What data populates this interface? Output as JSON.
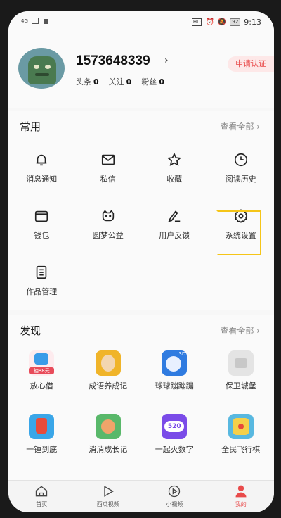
{
  "status_bar": {
    "signal": "4G",
    "hd": "HD",
    "battery": "92",
    "time": "9:13"
  },
  "profile": {
    "username": "1573648339",
    "stats": [
      {
        "label": "头条",
        "value": "0"
      },
      {
        "label": "关注",
        "value": "0"
      },
      {
        "label": "粉丝",
        "value": "0"
      }
    ],
    "verify_label": "申请认证"
  },
  "common": {
    "title": "常用",
    "more_label": "查看全部",
    "items": [
      {
        "label": "消息通知",
        "icon": "bell-icon"
      },
      {
        "label": "私信",
        "icon": "mail-icon"
      },
      {
        "label": "收藏",
        "icon": "star-icon"
      },
      {
        "label": "阅读历史",
        "icon": "clock-icon"
      },
      {
        "label": "钱包",
        "icon": "wallet-icon"
      },
      {
        "label": "圆梦公益",
        "icon": "charity-icon"
      },
      {
        "label": "用户反馈",
        "icon": "pen-icon"
      },
      {
        "label": "系统设置",
        "icon": "gear-icon"
      },
      {
        "label": "作品管理",
        "icon": "document-icon"
      }
    ]
  },
  "discover": {
    "title": "发现",
    "more_label": "查看全部",
    "items": [
      {
        "label": "放心借",
        "badge": "抽88元",
        "color": "#e84b5a"
      },
      {
        "label": "成语养成记",
        "color": "#f0b429"
      },
      {
        "label": "球球蹦蹦蹦",
        "badge": "3D",
        "color": "#2f7be0"
      },
      {
        "label": "保卫城堡",
        "color": "#dcdcdc"
      },
      {
        "label": "一锤到底",
        "color": "#3aa6e8"
      },
      {
        "label": "消消成长记",
        "color": "#59b86a"
      },
      {
        "label": "一起灭数字",
        "badge": "520",
        "color": "#7a4be8"
      },
      {
        "label": "全民飞行棋",
        "color": "#58b8e0"
      }
    ]
  },
  "tabbar": {
    "tabs": [
      {
        "label": "首页",
        "icon": "home-icon"
      },
      {
        "label": "西瓜视频",
        "icon": "play-icon"
      },
      {
        "label": "小视频",
        "icon": "short-video-icon"
      },
      {
        "label": "我的",
        "icon": "person-icon",
        "active": true
      }
    ]
  },
  "colors": {
    "accent": "#e94b4b",
    "highlight": "#f5c518"
  }
}
